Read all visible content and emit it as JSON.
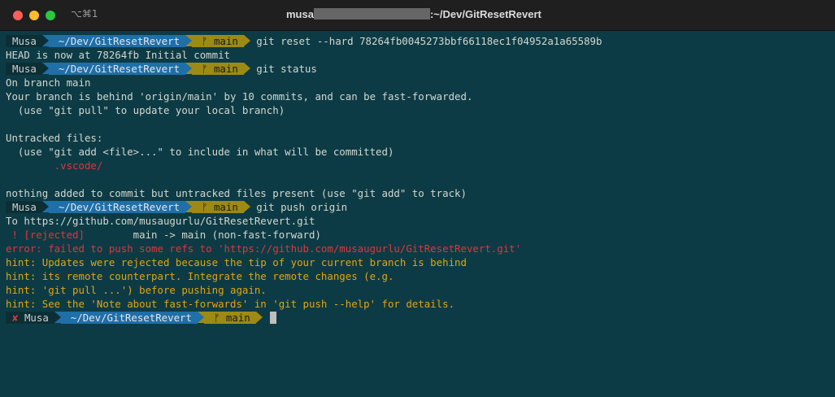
{
  "window": {
    "shortcut": "⌥⌘1",
    "title_prefix": "musa",
    "title_suffix": ":~/Dev/GitResetRevert"
  },
  "prompt": {
    "user": "Musa",
    "dir": "~/Dev/GitResetRevert",
    "branch": "ᚠ main",
    "error_mark": "✘"
  },
  "lines": {
    "cmd1": "git reset --hard 78264fb0045273bbf66118ec1f04952a1a65589b",
    "out1": "HEAD is now at 78264fb Initial commit",
    "cmd2": "git status",
    "out2": "On branch main",
    "out3": "Your branch is behind 'origin/main' by 10 commits, and can be fast-forwarded.",
    "out4": "  (use \"git pull\" to update your local branch)",
    "out5": "Untracked files:",
    "out6": "  (use \"git add <file>...\" to include in what will be committed)",
    "out7": "        .vscode/",
    "out8": "nothing added to commit but untracked files present (use \"git add\" to track)",
    "cmd3": "git push origin",
    "out9": "To https://github.com/musaugurlu/GitResetRevert.git",
    "out10a": " ! [rejected]",
    "out10b": "        main -> main (non-fast-forward)",
    "out11": "error: failed to push some refs to 'https://github.com/musaugurlu/GitResetRevert.git'",
    "out12": "hint: Updates were rejected because the tip of your current branch is behind",
    "out13": "hint: its remote counterpart. Integrate the remote changes (e.g.",
    "out14": "hint: 'git pull ...') before pushing again.",
    "out15": "hint: See the 'Note about fast-forwards' in 'git push --help' for details."
  },
  "colors": {
    "background": "#0d3b45",
    "dir_segment": "#1f6fa8",
    "branch_segment": "#9d8a14",
    "error": "#e0343b",
    "hint": "#e2a412"
  }
}
